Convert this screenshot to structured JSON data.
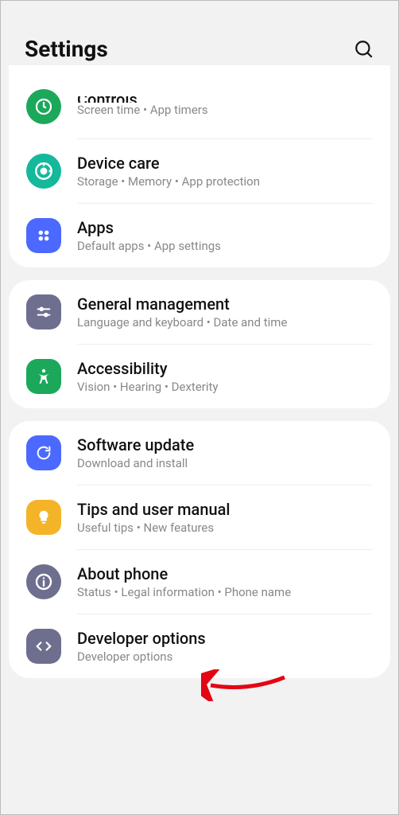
{
  "header": {
    "title": "Settings"
  },
  "groups": [
    {
      "items": [
        {
          "title": "Controls",
          "subtitle": "Screen time  •  App timers",
          "iconColor": "#1ba85a",
          "cutoff": true
        },
        {
          "title": "Device care",
          "subtitle": "Storage  •  Memory  •  App protection",
          "iconColor": "#14b89a"
        },
        {
          "title": "Apps",
          "subtitle": "Default apps  •  App settings",
          "iconColor": "#4b69ff"
        }
      ]
    },
    {
      "items": [
        {
          "title": "General management",
          "subtitle": "Language and keyboard  •  Date and time",
          "iconColor": "#6e6e8f"
        },
        {
          "title": "Accessibility",
          "subtitle": "Vision  •  Hearing  •  Dexterity",
          "iconColor": "#1ba85a"
        }
      ]
    },
    {
      "items": [
        {
          "title": "Software update",
          "subtitle": "Download and install",
          "iconColor": "#4b69ff"
        },
        {
          "title": "Tips and user manual",
          "subtitle": "Useful tips  •  New features",
          "iconColor": "#f4b427"
        },
        {
          "title": "About phone",
          "subtitle": "Status  •  Legal information  •  Phone name",
          "iconColor": "#6e6e8f",
          "highlighted": true
        },
        {
          "title": "Developer options",
          "subtitle": "Developer options",
          "iconColor": "#6e6e8f"
        }
      ]
    }
  ]
}
